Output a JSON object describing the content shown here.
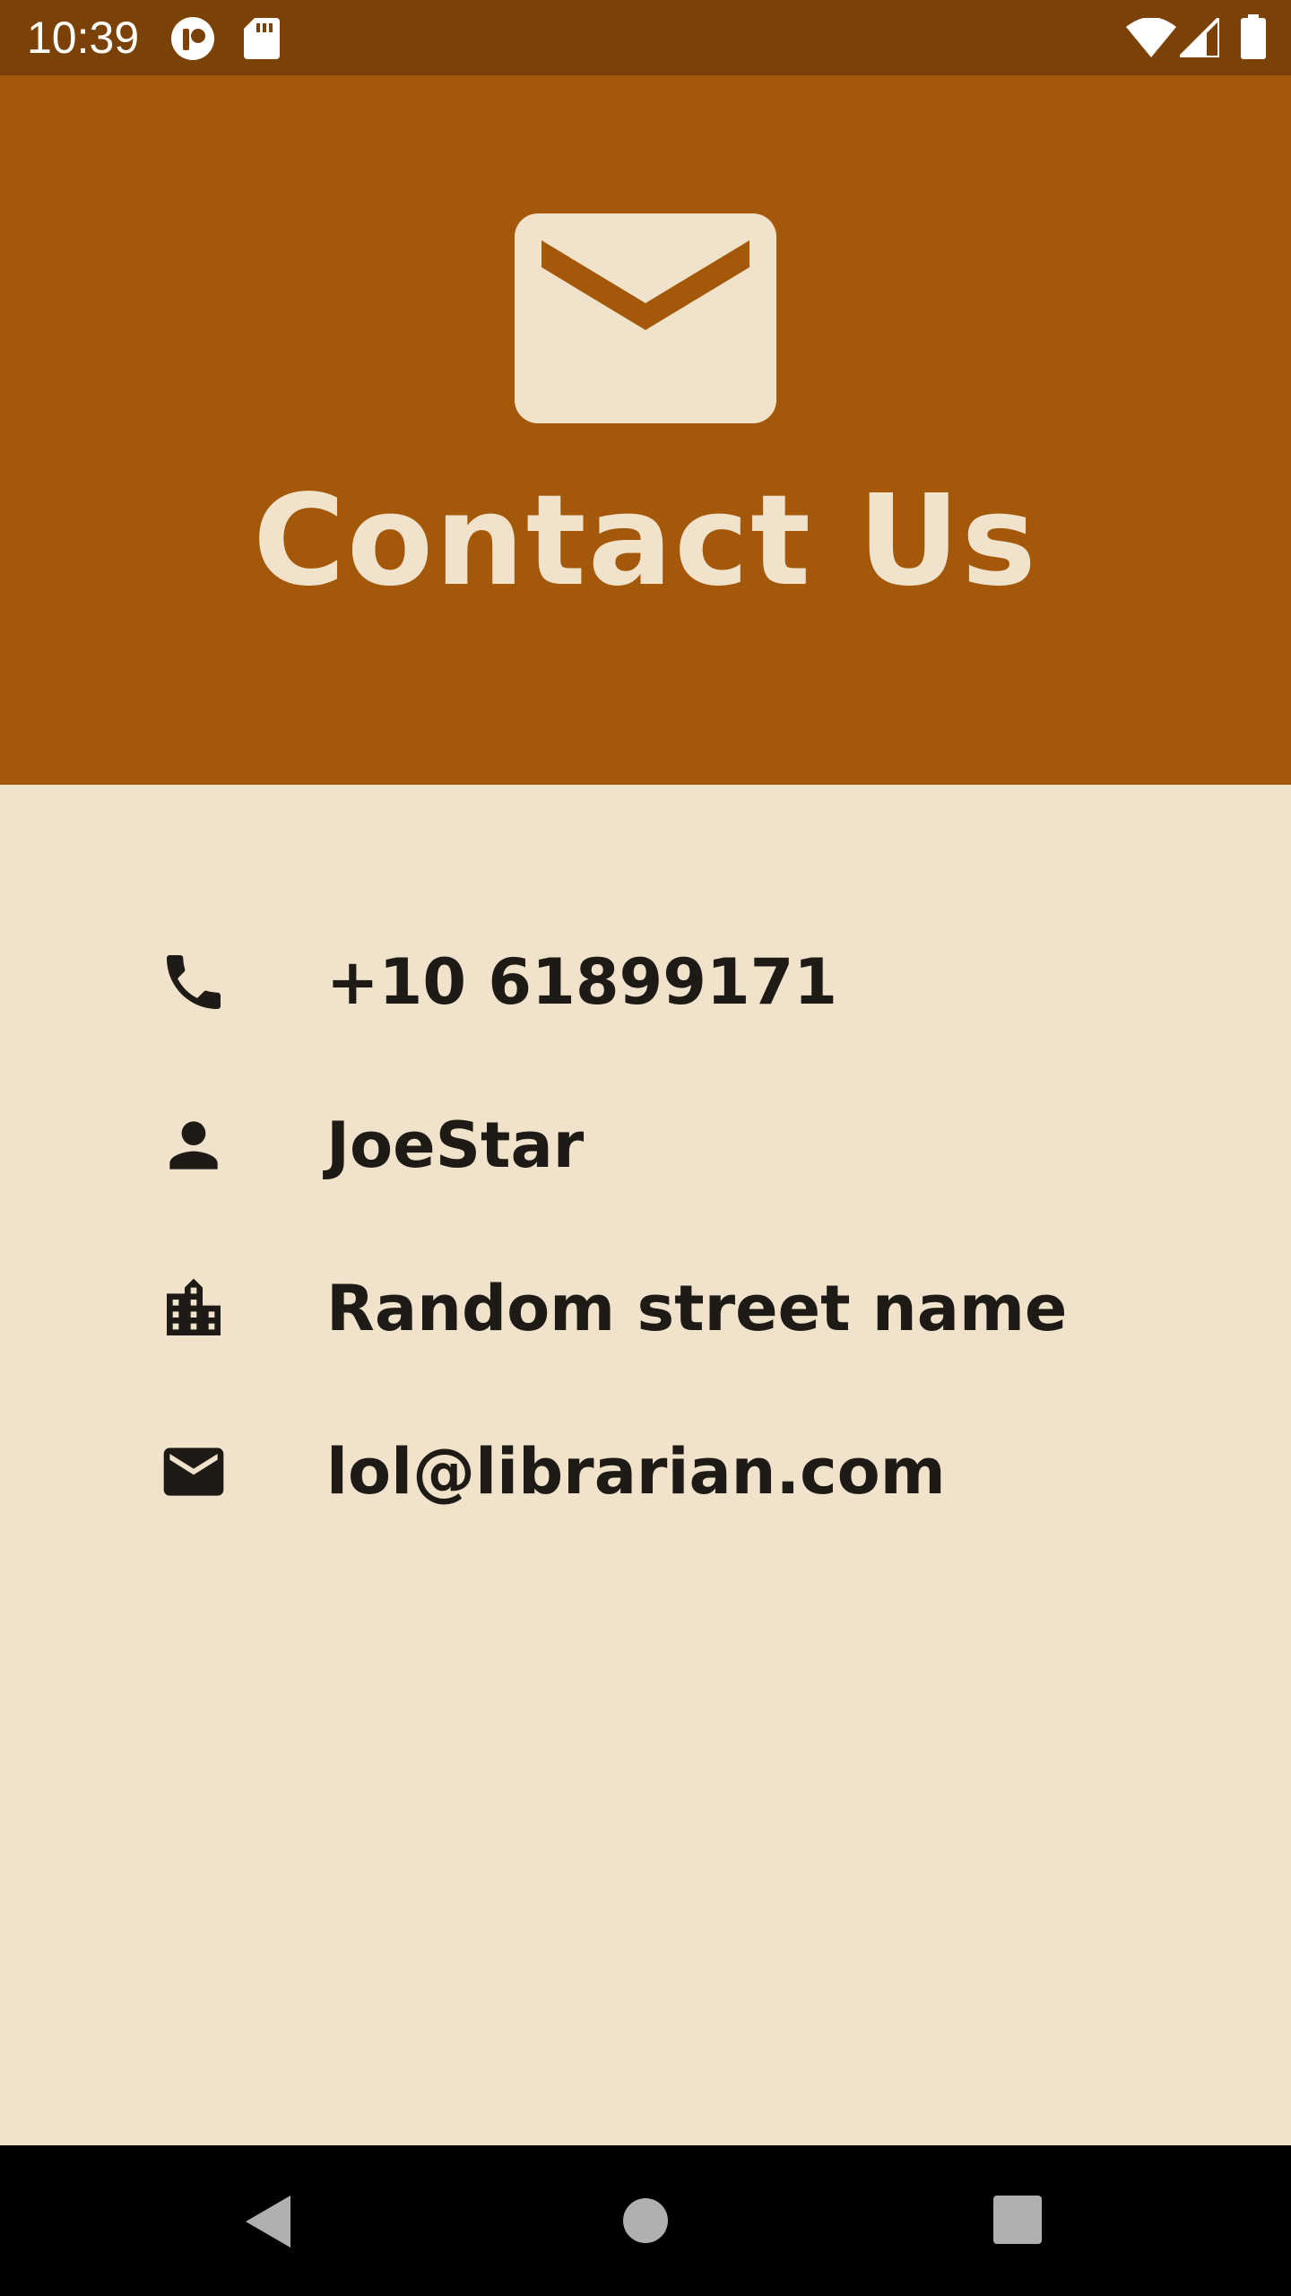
{
  "status_bar": {
    "time": "10:39",
    "icons": [
      "notification-app-icon",
      "sd-card-icon",
      "wifi-icon",
      "cell-signal-icon",
      "battery-icon"
    ]
  },
  "header": {
    "icon": "mail-icon",
    "title": "Contact Us"
  },
  "contacts": [
    {
      "icon": "phone-icon",
      "value": "+10 61899171"
    },
    {
      "icon": "person-icon",
      "value": "JoeStar"
    },
    {
      "icon": "building-icon",
      "value": "Random street name"
    },
    {
      "icon": "mail-icon",
      "value": "lol@librarian.com"
    }
  ],
  "nav_bar": {
    "buttons": [
      "back-icon",
      "home-icon",
      "recents-icon"
    ]
  },
  "colors": {
    "status_bar": "#7A4206",
    "header": "#A3580A",
    "background": "#F1E3CB",
    "text": "#1E1A15",
    "nav_bar": "#000000"
  }
}
